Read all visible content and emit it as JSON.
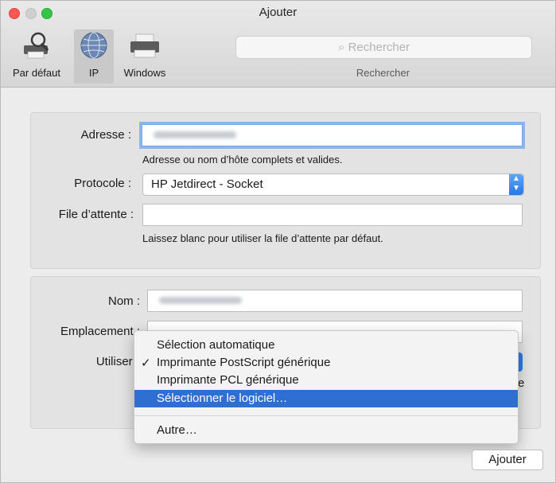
{
  "window": {
    "title": "Ajouter"
  },
  "toolbar": {
    "items": [
      {
        "label": "Par défaut",
        "icon": "default-printer-magnifier-icon"
      },
      {
        "label": "IP",
        "icon": "globe-icon",
        "selected": true
      },
      {
        "label": "Windows",
        "icon": "windows-printer-icon"
      }
    ],
    "search": {
      "placeholder": "Rechercher",
      "label": "Rechercher"
    }
  },
  "form": {
    "address": {
      "label": "Adresse :",
      "value": "",
      "hint": "Adresse ou nom d’hôte complets et valides."
    },
    "protocol": {
      "label": "Protocole :",
      "value": "HP Jetdirect - Socket"
    },
    "queue": {
      "label": "File d’attente :",
      "value": "",
      "hint": "Laissez blanc pour utiliser la file d’attente par défaut."
    },
    "name": {
      "label": "Nom :",
      "value": ""
    },
    "location": {
      "label": "Emplacement :",
      "value": ""
    },
    "use": {
      "label": "Utiliser :"
    }
  },
  "menu": {
    "items": [
      {
        "label": "Sélection automatique",
        "checked": false,
        "highlighted": false
      },
      {
        "label": "Imprimante PostScript générique",
        "checked": true,
        "highlighted": false
      },
      {
        "label": "Imprimante PCL générique",
        "checked": false,
        "highlighted": false
      },
      {
        "label": "Sélectionner le logiciel…",
        "checked": false,
        "highlighted": true
      },
      {
        "label": "Autre…",
        "checked": false,
        "highlighted": false
      }
    ],
    "check_glyph": "✓"
  },
  "buttons": {
    "add": "Ajouter"
  },
  "colors": {
    "accent": "#2f6ed3",
    "focus_ring": "#8bb5ee"
  }
}
